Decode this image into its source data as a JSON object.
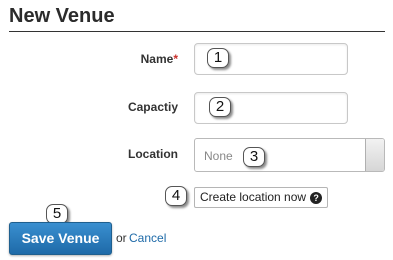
{
  "page": {
    "title": "New Venue"
  },
  "form": {
    "name": {
      "label": "Name",
      "required_marker": "*",
      "value": ""
    },
    "capacity": {
      "label": "Capactiy",
      "value": ""
    },
    "location": {
      "label": "Location",
      "selected": "None"
    },
    "create_location_button": "Create location now",
    "help_icon_glyph": "?"
  },
  "actions": {
    "save_label": "Save Venue",
    "or_text": "or",
    "cancel_label": "Cancel"
  },
  "annotations": [
    "1",
    "2",
    "3",
    "4",
    "5"
  ]
}
